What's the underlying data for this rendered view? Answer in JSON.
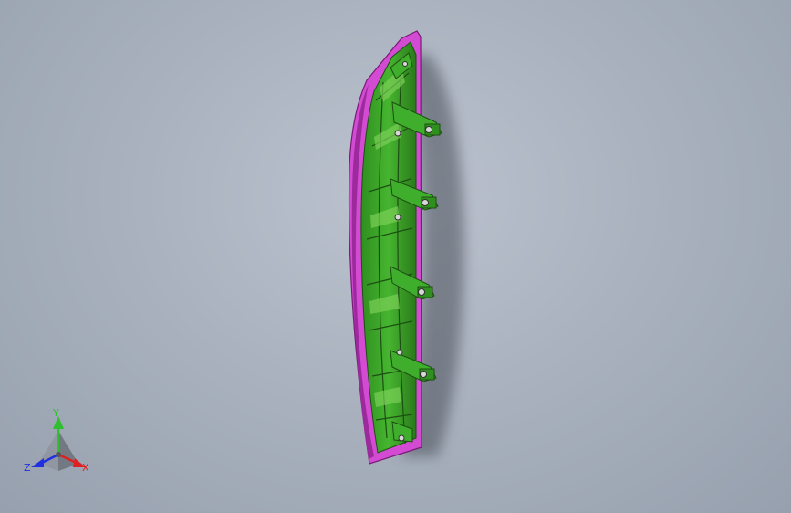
{
  "viewport": {
    "background_top": "#bcc3cf",
    "background_bottom": "#97a0ae"
  },
  "model": {
    "frame_color": "#d24bd2",
    "frame_dark": "#8a1f8a",
    "part_color": "#3fae2c",
    "part_dark": "#1f5e14",
    "part_light": "#7fd35a",
    "fastener_color": "#d8d8d8",
    "mount_bracket_count": 4
  },
  "triad": {
    "x_label": "X",
    "y_label": "Y",
    "z_label": "Z",
    "x_color": "#e02020",
    "y_color": "#2fbf2f",
    "z_color": "#2030e0"
  }
}
